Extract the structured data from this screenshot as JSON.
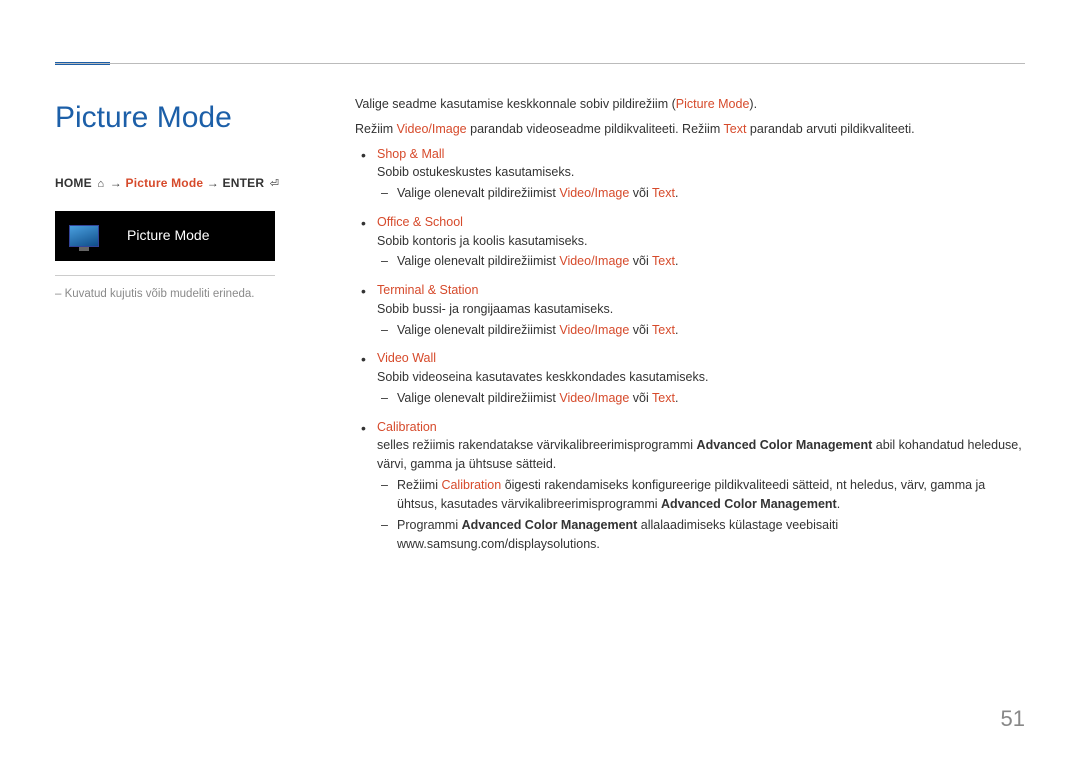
{
  "title": "Picture Mode",
  "breadcrumb": {
    "home": "HOME",
    "step": "Picture Mode",
    "enter": "ENTER"
  },
  "thumbnail": {
    "label": "Picture Mode"
  },
  "left_footnote": "Kuvatud kujutis võib mudeliti erineda.",
  "intro": {
    "prefix": "Valige seadme kasutamise keskkonnale sobiv pildirežiim (",
    "mode": "Picture Mode",
    "suffix": ")."
  },
  "line2": {
    "a": "Režiim ",
    "vi": "Video/Image",
    "b": " parandab videoseadme pildikvaliteeti. Režiim ",
    "tx": "Text",
    "c": " parandab arvuti pildikvaliteeti."
  },
  "common_sub": {
    "pre": "Valige olenevalt pildirežiimist ",
    "mid": " või ",
    "post": ".",
    "vi": "Video/Image",
    "tx": "Text"
  },
  "modes": {
    "shop": {
      "head": "Shop & Mall",
      "desc": "Sobib ostukeskustes kasutamiseks."
    },
    "office": {
      "head": "Office & School",
      "desc": "Sobib kontoris ja koolis kasutamiseks."
    },
    "terminal": {
      "head": "Terminal & Station",
      "desc": "Sobib bussi- ja rongijaamas kasutamiseks."
    },
    "wall": {
      "head": "Video Wall",
      "desc": "Sobib videoseina kasutavates keskkondades kasutamiseks."
    }
  },
  "calibration": {
    "head": "Calibration",
    "desc_a": "selles režiimis rakendatakse värvikalibreerimisprogrammi ",
    "desc_b": "Advanced Color Management",
    "desc_c": " abil kohandatud heleduse, värvi, gamma ja ühtsuse sätteid.",
    "sub1_a": "Režiimi ",
    "sub1_b": "Calibration",
    "sub1_c": " õigesti rakendamiseks konfigureerige pildikvaliteedi sätteid, nt heledus, värv, gamma ja ühtsus, kasutades värvikalibreerimisprogrammi ",
    "sub1_d": "Advanced Color Management",
    "sub1_e": ".",
    "sub2_a": "Programmi ",
    "sub2_b": "Advanced Color Management",
    "sub2_c": " allalaadimiseks külastage veebisaiti www.samsung.com/displaysolutions."
  },
  "page_number": "51"
}
